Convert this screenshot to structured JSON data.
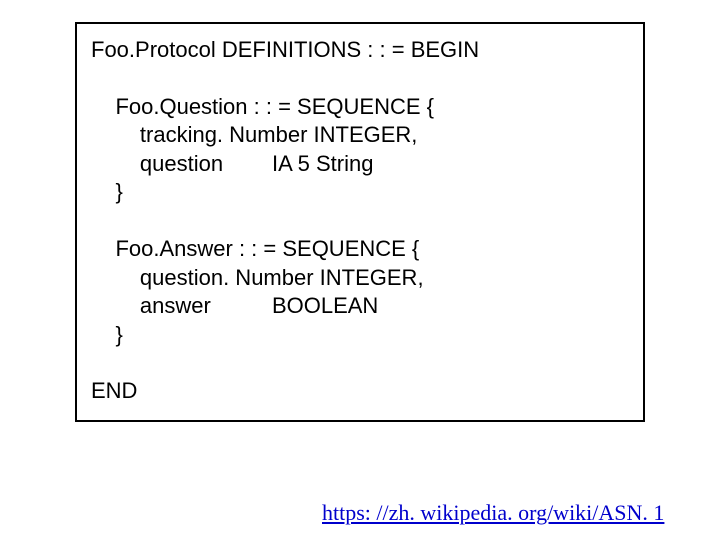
{
  "code": {
    "line1": "Foo.Protocol DEFINITIONS : : = BEGIN",
    "line2": "    Foo.Question : : = SEQUENCE {",
    "line3": "        tracking. Number INTEGER,",
    "line4": "        question        IA 5 String",
    "line5": "    }",
    "line6": "    Foo.Answer : : = SEQUENCE {",
    "line7": "        question. Number INTEGER,",
    "line8": "        answer          BOOLEAN",
    "line9": "    }",
    "line10": "END"
  },
  "link_text": "https: //zh. wikipedia. org/wiki/ASN. 1"
}
